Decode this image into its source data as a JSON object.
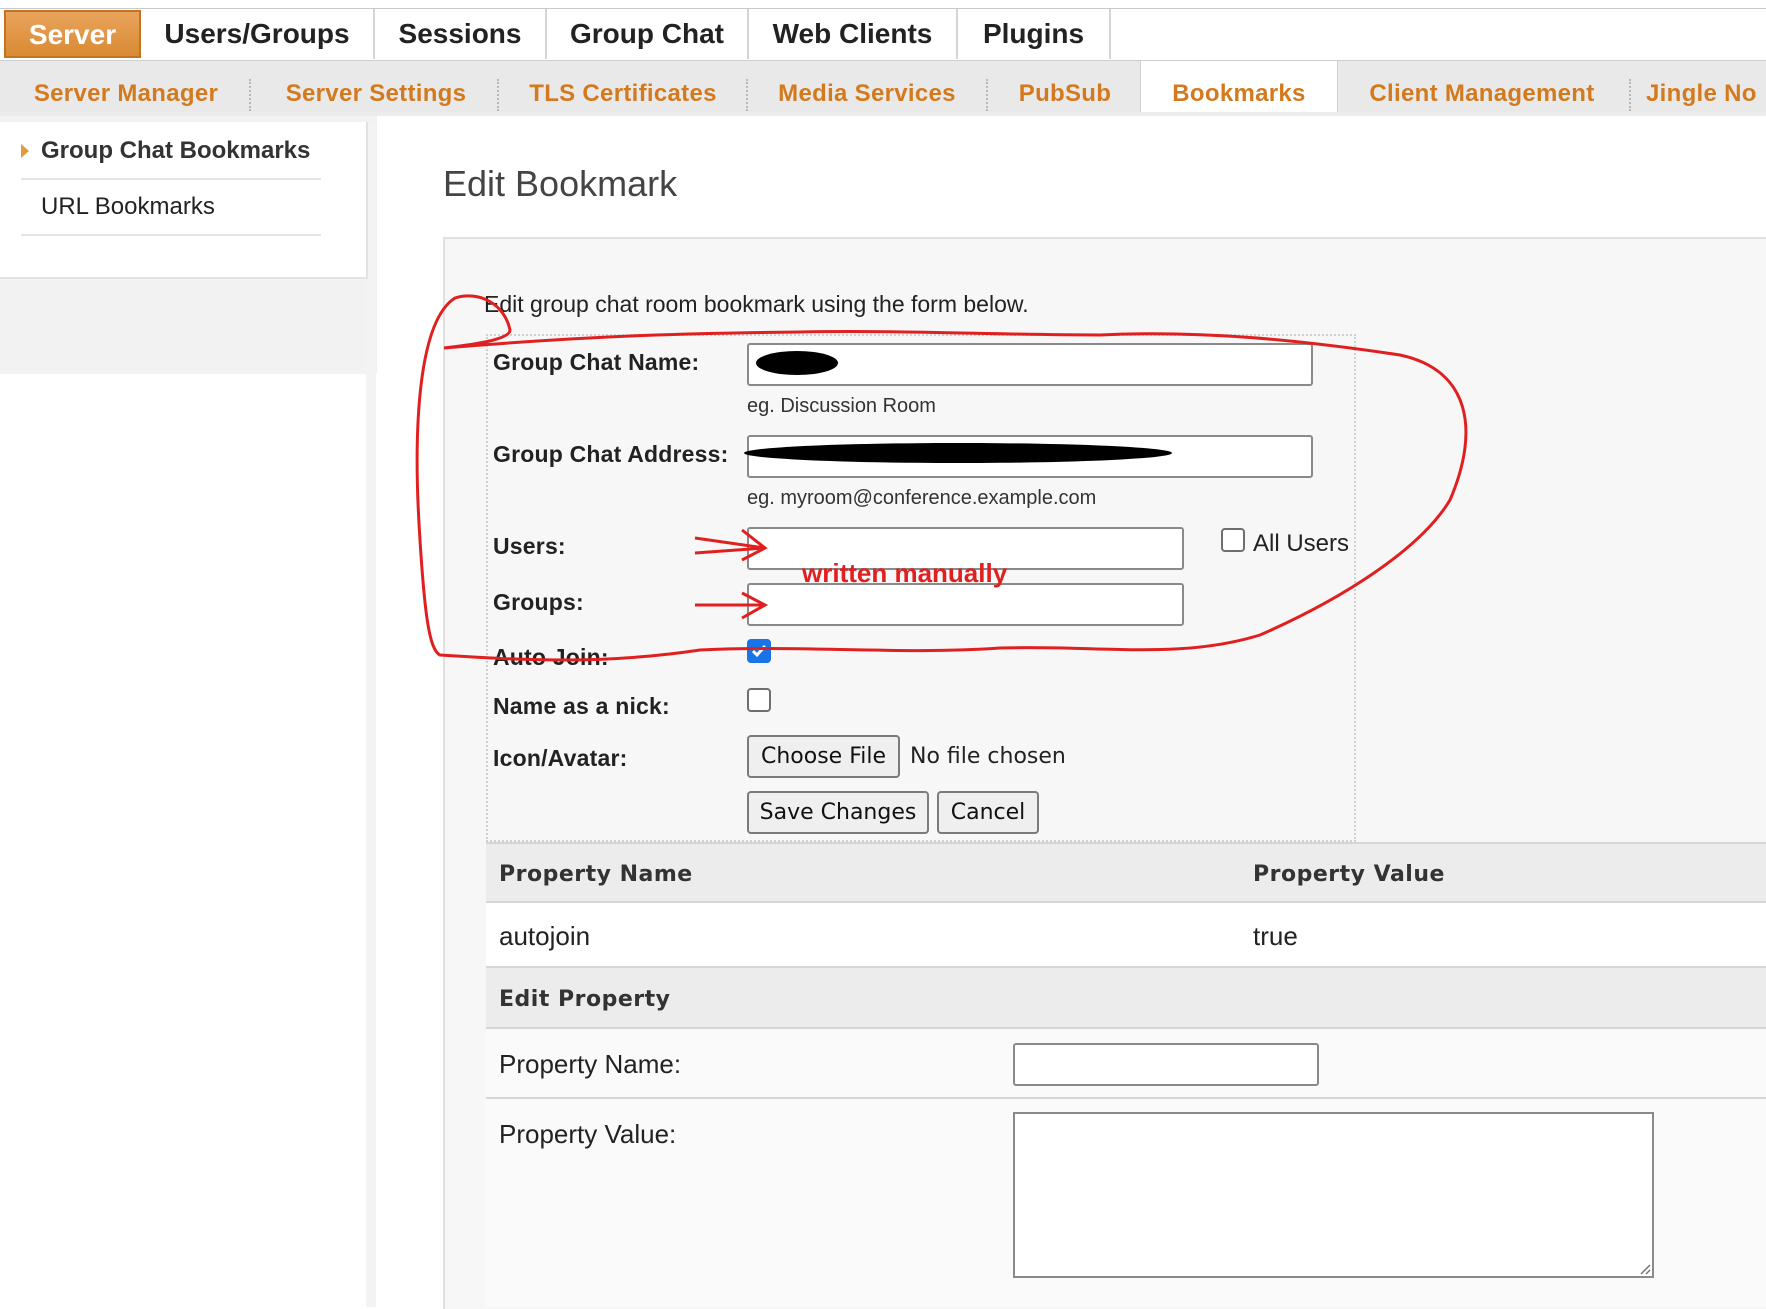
{
  "main_tabs": [
    "Server",
    "Users/Groups",
    "Sessions",
    "Group Chat",
    "Web Clients",
    "Plugins"
  ],
  "active_main_tab": "Server",
  "sub_tabs": [
    "Server Manager",
    "Server Settings",
    "TLS Certificates",
    "Media Services",
    "PubSub",
    "Bookmarks",
    "Client Management",
    "Jingle No"
  ],
  "active_sub_tab": "Bookmarks",
  "sidebar": {
    "items": [
      "Group Chat Bookmarks",
      "URL Bookmarks"
    ],
    "active": "Group Chat Bookmarks"
  },
  "page": {
    "title": "Edit Bookmark",
    "intro": "Edit group chat room bookmark using the form below."
  },
  "form": {
    "name_label": "Group Chat Name:",
    "name_hint": "eg. Discussion Room",
    "address_label": "Group Chat Address:",
    "address_hint": "eg. myroom@conference.example.com",
    "users_label": "Users:",
    "all_users_label": "All Users",
    "groups_label": "Groups:",
    "autojoin_label": "Auto Join:",
    "nick_label": "Name as a nick:",
    "icon_label": "Icon/Avatar:",
    "choose_file": "Choose File",
    "no_file": "No file chosen",
    "save": "Save Changes",
    "cancel": "Cancel",
    "autojoin_checked": true,
    "nick_checked": false,
    "all_users_checked": false
  },
  "properties": {
    "col_name": "Property Name",
    "col_value": "Property Value",
    "rows": [
      {
        "name": "autojoin",
        "value": "true"
      }
    ],
    "edit_header": "Edit Property",
    "edit_name_label": "Property Name:",
    "edit_value_label": "Property Value:"
  },
  "annotation": {
    "text": "written manually",
    "color": "#e02020"
  },
  "colors": {
    "accent_orange": "#d47a1e",
    "active_tab": "#e09440"
  }
}
